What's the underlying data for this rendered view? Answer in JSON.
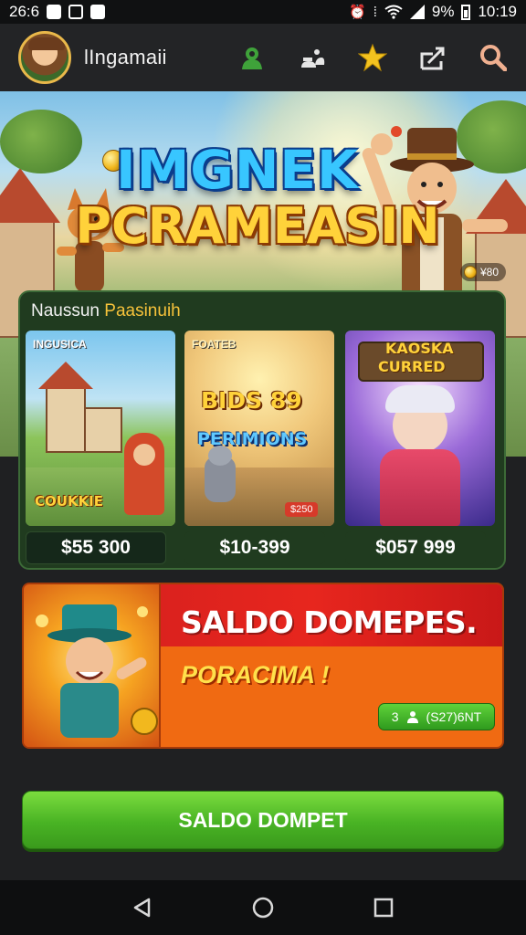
{
  "status_bar": {
    "left_text": "26:6",
    "battery_percent": "9%",
    "time": "10:19"
  },
  "header": {
    "app_name": "lIngamaii",
    "icons": [
      "profile-icon",
      "users-icon",
      "star-icon",
      "share-icon",
      "search-icon"
    ],
    "icon_colors": {
      "profile": "#3fa23a",
      "users": "#e6e6e6",
      "star": "#f3c21f",
      "share": "#e6e6e6",
      "search": "#f0b090"
    }
  },
  "hero": {
    "title_line1": "IMGNEK",
    "title_line2": "PCRAMEASIN",
    "coin_chip": "¥80"
  },
  "games": {
    "section_title_a": "Naussun ",
    "section_title_b": "Paasinuih",
    "items": [
      {
        "tag": "INGUSICA",
        "art_title": "COUKKIE",
        "price": "$55 300"
      },
      {
        "tag": "FOATEB",
        "art_title_1": "BIDS 89",
        "art_title_2": "PERIMIONS",
        "badge": "$250",
        "price": "$10-399"
      },
      {
        "tag": "",
        "art_title_1": "KAOSKA",
        "art_title_2": "CURRED",
        "price": "$057 999"
      }
    ]
  },
  "promo": {
    "title": "SALDO DOMEPES.",
    "subtitle": "PORACIMA !",
    "chip_num": "3",
    "chip_text": "(S27)6NT"
  },
  "cta": {
    "label": "SALDO DOMPET"
  },
  "nav": {
    "icons": [
      "back-icon",
      "home-icon",
      "recents-icon"
    ]
  }
}
